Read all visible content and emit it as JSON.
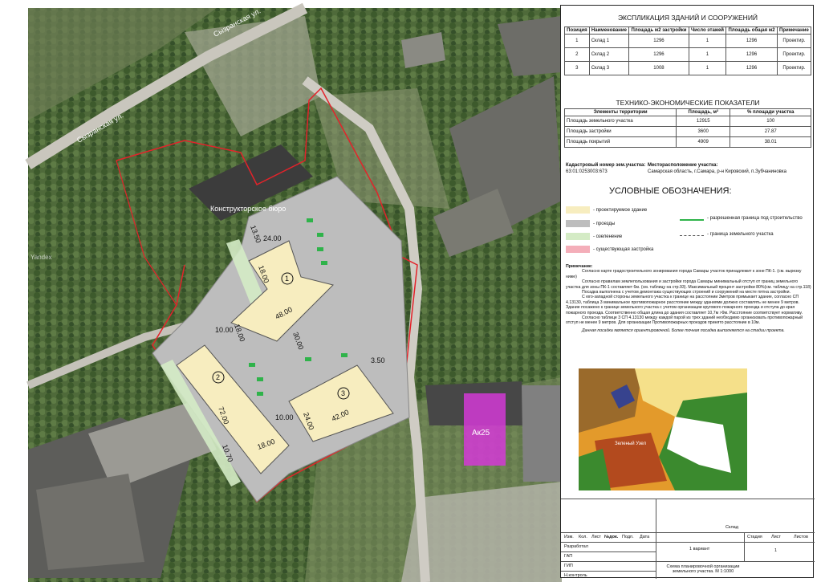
{
  "explication": {
    "title": "ЭКСПЛИКАЦИЯ ЗДАНИЙ И СООРУЖЕНИЙ",
    "headers": [
      "Позиция",
      "Наименование",
      "Площадь м2 застройки",
      "Число этажей",
      "Площадь общая м2",
      "Примечание"
    ],
    "rows": [
      [
        "1",
        "Склад 1",
        "1296",
        "1",
        "1296",
        "Проектир."
      ],
      [
        "2",
        "Склад  2",
        "1296",
        "1",
        "1296",
        "Проектир."
      ],
      [
        "3",
        "Склад 3",
        "1008",
        "1",
        "1296",
        "Проектир."
      ]
    ]
  },
  "tep": {
    "title": "ТЕХНИКО-ЭКОНОМИЧЕСКИЕ ПОКАЗАТЕЛИ",
    "headers": [
      "Элементы территории",
      "Площадь, м²",
      "% площади участка"
    ],
    "rows": [
      [
        "Площадь земельного участка",
        "12915",
        "100"
      ],
      [
        "Площадь застройки",
        "3600",
        "27.87"
      ],
      [
        "Площадь покрытий",
        "4909",
        "38.01"
      ]
    ]
  },
  "cadastre": {
    "label": "Кадастровый номер зем.участка:",
    "number": "63:01:0253003:673",
    "location_label": "Месторасположение участка:",
    "location": "Самарская область, г.Самара, р-н Кировский, п.Зубчаниновка"
  },
  "legend": {
    "title": "УСЛОВНЫЕ ОБОЗНАЧЕНИЯ:",
    "items": [
      {
        "label": "- проектируемое здание",
        "color": "#f7edbf"
      },
      {
        "label": "- проезды",
        "color": "#bdbdbd"
      },
      {
        "label": "- озеленение",
        "color": "#d4ebc5"
      },
      {
        "label": "- существующая застройка",
        "color": "#f4aeb9"
      }
    ],
    "lines": [
      {
        "label": "- разрешенная граница под строительство",
        "color": "#2fb34a"
      },
      {
        "label": "- граница земельного участка",
        "color": "#555555"
      }
    ]
  },
  "notes": {
    "title": "Примечание:",
    "paragraphs": [
      "Согласно карте градостроительного зонирования города Самары участок принадлежит к зоне ПК-1. (см. вырезку ниже)",
      "Согласно правилам землепользования и застройки города Самары минимальный отступ от границ земельного участка для зоны ПК-1 составляет 6м. (см. таблицу на стр.93). Максимальный процент застройки 80%(см. таблицу на стр.118)",
      "Посадка выполнена с учетом демонтажа существующих строений и сооружений на месте пятна застройки.",
      "С юго-западной стороны земельного участка к границе на расстоянии 3метров примыкает здание, согласно СП 4.13130, таблица 3 минимальное противопожарное расстояние между зданиями должно составлять не менее 9 метров. Здание посажено к границе земельного участка с учетом организации кругового пожарного проезда и отступа до края пожарного проезда. Соответственно общая длина до здания составляет 10,7м >9м. Расстояние соответствует нормативу.",
      "Согласно таблице 3  СП 4.13130 между каждой парой из трех зданий необходимо организовать противопожарный отступ не менее 9 метров. Для организации Противопожарных проездов принято расстояние в 10м.",
      "Данная посадка является ориентировочной. Более точная посадка выполняется на стадии проекта."
    ]
  },
  "map_labels": {
    "street1": "Сызранская ул.",
    "street2": "Сызранская ул.",
    "poi": "Конструкторское бюро",
    "zone": "Ак25",
    "watermark": "Yandex",
    "zone_map_label": "Зеленый Узел"
  },
  "buildings": [
    {
      "num": "1",
      "dims": [
        "24.00",
        "18.00",
        "48.00",
        "18.00"
      ]
    },
    {
      "num": "2",
      "dims": [
        "72.00",
        "18.00"
      ]
    },
    {
      "num": "3",
      "dims": [
        "42.00",
        "24.00"
      ]
    }
  ],
  "spacings": [
    "13.50",
    "10.00",
    "30.00",
    "10.00",
    "3.50",
    "10.70"
  ],
  "stamp": {
    "headers": [
      "Изм.",
      "Кол.",
      "Лист",
      "№док.",
      "Подп.",
      "Дата"
    ],
    "rows": [
      "Разработал",
      "ГАП",
      "ГИП",
      "Н.контроль"
    ],
    "object": "Склад",
    "variant": "1 вариант",
    "stage_headers": [
      "Стадия",
      "Лист",
      "Листов"
    ],
    "sheet": "1",
    "sheet_title": "Схема планировочной организации земельного участка. М 1:1000"
  }
}
